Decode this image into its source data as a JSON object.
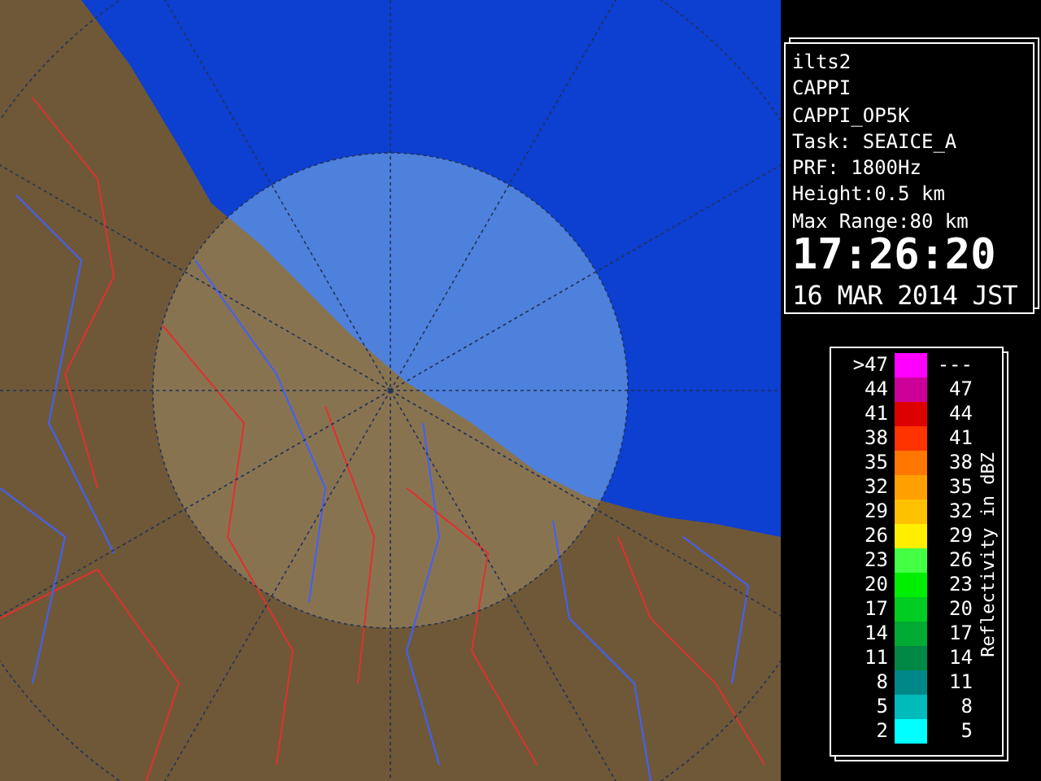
{
  "info_panel": {
    "lines": [
      "ilts2",
      "CAPPI",
      "CAPPI_OP5K",
      "Task: SEAICE_A",
      "PRF: 1800Hz",
      "Height:0.5 km",
      "Max Range:80 km"
    ],
    "time": "17:26:20",
    "date": "16 MAR 2014 JST"
  },
  "legend": {
    "title": "Reflectivity in dBZ",
    "rows": [
      {
        "low": ">47",
        "high": "---",
        "color": "#ff00ff"
      },
      {
        "low": "44",
        "high": "47",
        "color": "#cc0099"
      },
      {
        "low": "41",
        "high": "44",
        "color": "#dd0000"
      },
      {
        "low": "38",
        "high": "41",
        "color": "#ff3300"
      },
      {
        "low": "35",
        "high": "38",
        "color": "#ff7700"
      },
      {
        "low": "32",
        "high": "35",
        "color": "#ffa000"
      },
      {
        "low": "29",
        "high": "32",
        "color": "#ffc000"
      },
      {
        "low": "26",
        "high": "29",
        "color": "#ffee00"
      },
      {
        "low": "23",
        "high": "26",
        "color": "#44ff44"
      },
      {
        "low": "20",
        "high": "23",
        "color": "#00ee00"
      },
      {
        "low": "17",
        "high": "20",
        "color": "#00cc22"
      },
      {
        "low": "14",
        "high": "17",
        "color": "#00aa33"
      },
      {
        "low": "11",
        "high": "14",
        "color": "#008844"
      },
      {
        "low": "8",
        "high": "11",
        "color": "#008888"
      },
      {
        "low": "5",
        "high": "8",
        "color": "#00bbbb"
      },
      {
        "low": "2",
        "high": "5",
        "color": "#00ffff"
      }
    ]
  }
}
